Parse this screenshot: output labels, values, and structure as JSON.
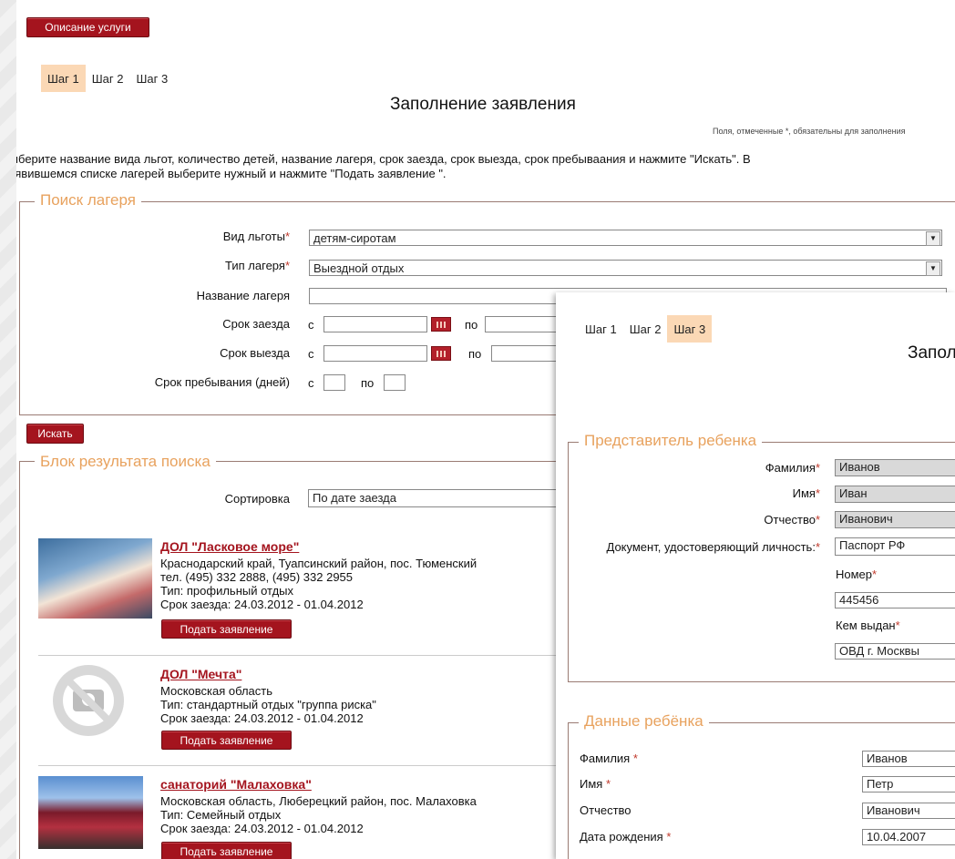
{
  "top_button": "Описание услуги",
  "steps": [
    "Шаг 1",
    "Шаг 2",
    "Шаг 3"
  ],
  "title": "Заполнение заявления",
  "required_note": "Поля, отмеченные *, обязательны для заполнения",
  "intro_line1": "Выберите название вида льгот, количество детей, название лагеря, срок заезда, срок выезда, срок пребываания и нажмите \"Искать\". В",
  "intro_line2": "появившемся списке лагерей выберите нужный и нажмите \"Подать заявление \".",
  "search": {
    "legend": "Поиск лагеря",
    "benefit_label": "Вид льготы",
    "benefit_value": "детям-сиротам",
    "camp_type_label": "Тип лагеря",
    "camp_type_value": "Выездной отдых",
    "camp_name_label": "Название лагеря",
    "arrival_label": "Срок заезда",
    "departure_label": "Срок выезда",
    "stay_label": "Срок пребывания (дней)",
    "from": "с",
    "to": "по",
    "asterisk": "*"
  },
  "search_button": "Искать",
  "results": {
    "legend": "Блок результата поиска",
    "sort_label": "Сортировка",
    "sort_value": "По дате заезда",
    "apply_label": "Подать заявление",
    "items": [
      {
        "title": "ДОЛ \"Ласковое море\"",
        "lines": [
          "Краснодарский край, Туапсинский район, пос. Тюменский",
          "тел. (495) 332 2888, (495) 332 2955",
          "Тип: профильный отдых",
          "Срок заезда: 24.03.2012 - 01.04.2012"
        ]
      },
      {
        "title": "ДОЛ \"Мечта\"",
        "lines": [
          "Московская область",
          "Тип: стандартный отдых \"группа риска\"",
          "Срок заезда: 24.03.2012 - 01.04.2012"
        ]
      },
      {
        "title": "санаторий \"Малаховка\"",
        "lines": [
          "Московская область, Люберецкий район, пос. Малаховка",
          "Тип: Семейный отдых",
          "Срок заезда: 24.03.2012 - 01.04.2012"
        ]
      }
    ]
  },
  "overlay": {
    "steps": [
      "Шаг 1",
      "Шаг 2",
      "Шаг 3"
    ],
    "title_partial": "Запол",
    "rep": {
      "legend": "Представитель ребенка",
      "surname_label": "Фамилия",
      "surname_value": "Иванов",
      "name_label": "Имя",
      "name_value": "Иван",
      "patronymic_label": "Отчество",
      "patronymic_value": "Иванович",
      "doc_label": "Документ, удостоверяющий личность:",
      "doc_value": "Паспорт РФ",
      "number_label": "Номер",
      "number_value": "445456",
      "issued_label": "Кем выдан",
      "issued_value": "ОВД г. Москвы"
    },
    "child": {
      "legend": "Данные ребёнка",
      "surname_label": "Фамилия ",
      "surname_value": "Иванов",
      "name_label": "Имя ",
      "name_value": "Петр",
      "patronymic_label": "Отчество",
      "patronymic_value": "Иванович",
      "dob_label": "Дата рождения ",
      "dob_value": "10.04.2007"
    }
  }
}
